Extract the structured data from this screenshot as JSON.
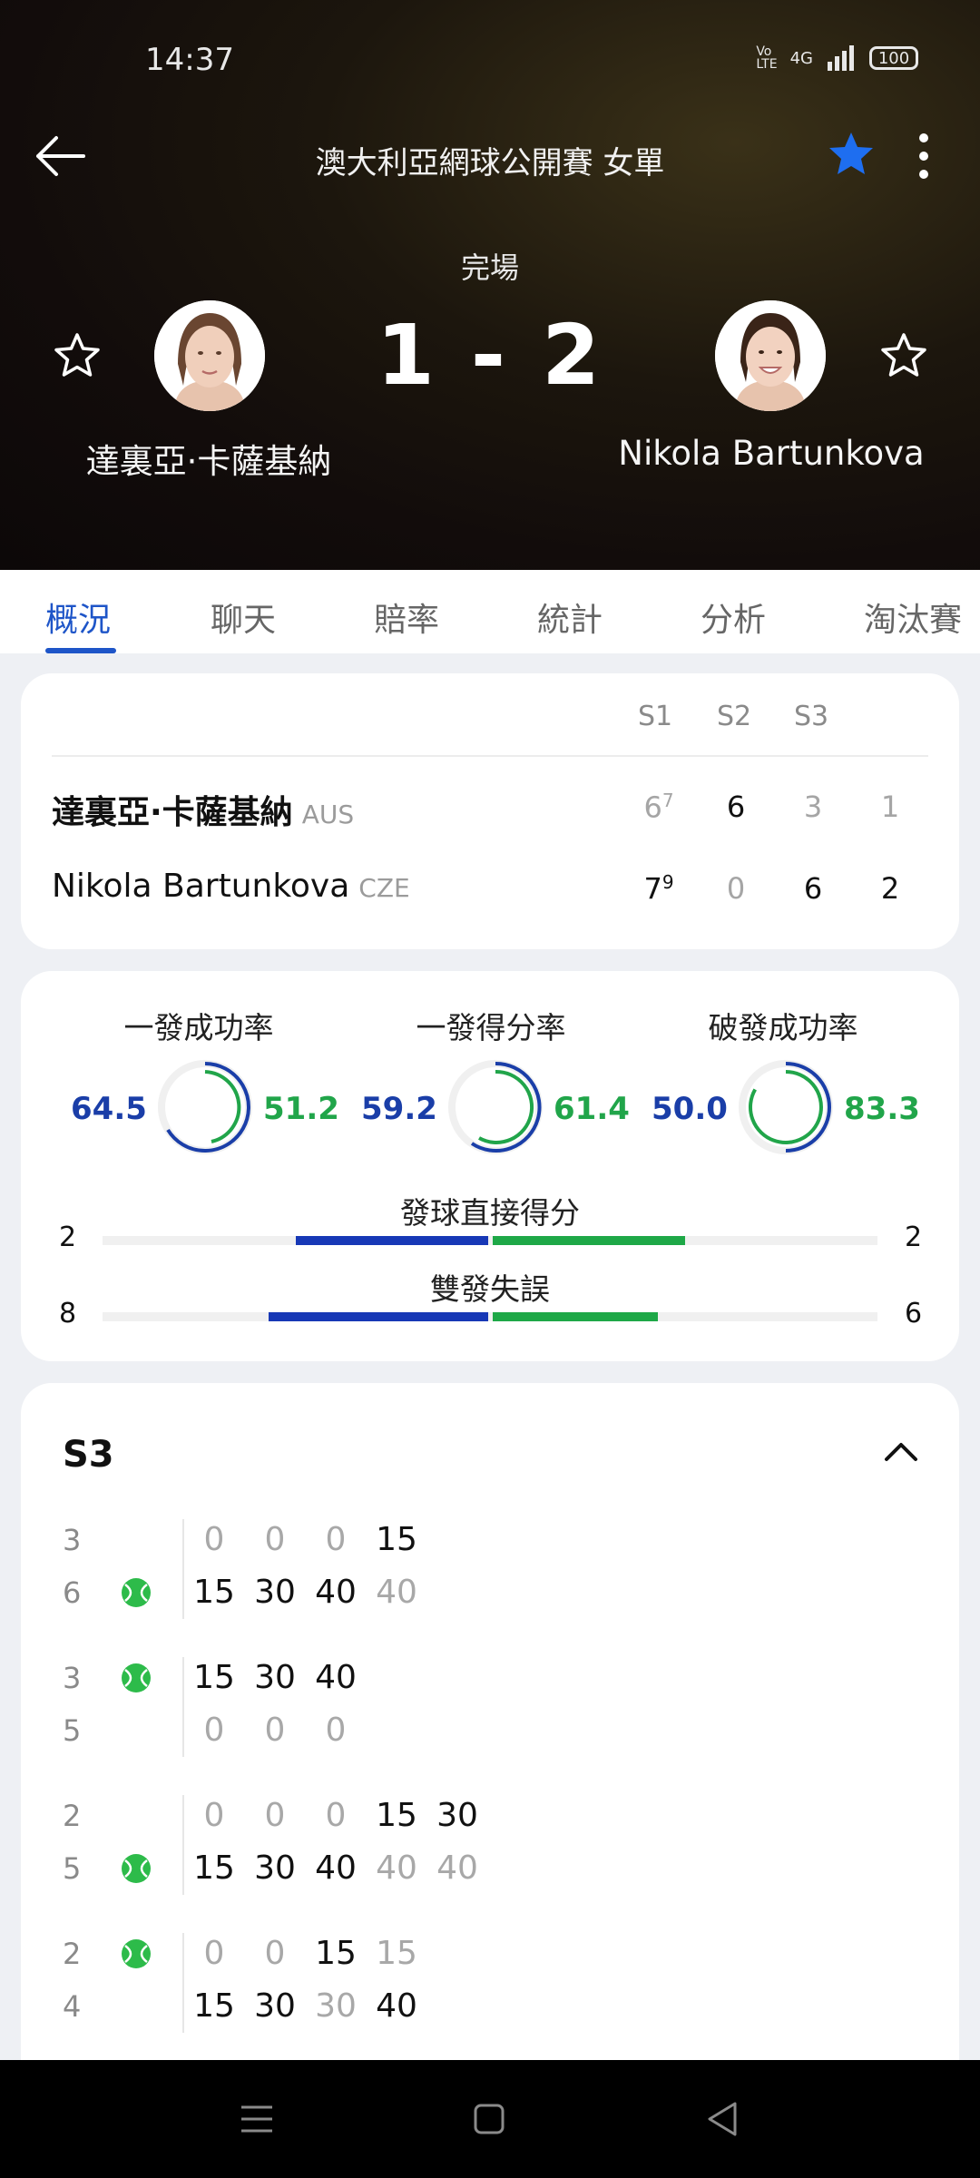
{
  "status": {
    "time": "14:37",
    "network": "4G",
    "battery": "100"
  },
  "header": {
    "title": "澳大利亞網球公開賽 女單",
    "match_status": "完場",
    "score": "1 - 2",
    "player_left": "達裏亞·卡薩基納",
    "player_right": "Nikola Bartunkova"
  },
  "tabs": [
    "概況",
    "聊天",
    "賠率",
    "統計",
    "分析",
    "淘汰賽"
  ],
  "scoreboard": {
    "set_headers": [
      "S1",
      "S2",
      "S3"
    ],
    "rows": [
      {
        "name": "達裏亞·卡薩基納",
        "country": "AUS",
        "s1": "6",
        "s1_tb": "7",
        "s2": "6",
        "s3": "3",
        "total": "1"
      },
      {
        "name": "Nikola Bartunkova",
        "country": "CZE",
        "s1": "7",
        "s1_tb": "9",
        "s2": "0",
        "s3": "6",
        "total": "2"
      }
    ]
  },
  "stats": {
    "rings": [
      {
        "label": "一發成功率",
        "left": "64.5",
        "right": "51.2"
      },
      {
        "label": "一發得分率",
        "left": "59.2",
        "right": "61.4"
      },
      {
        "label": "破發成功率",
        "left": "50.0",
        "right": "83.3"
      }
    ],
    "bars": [
      {
        "label": "發球直接得分",
        "left": "2",
        "right": "2"
      },
      {
        "label": "雙發失誤",
        "left": "8",
        "right": "6"
      }
    ]
  },
  "set_detail": {
    "title": "S3",
    "games": [
      {
        "top_games": "3",
        "bottom_games": "6",
        "server": "bottom",
        "top_points": [
          "0",
          "0",
          "0",
          "15"
        ],
        "top_dim": [
          true,
          true,
          true,
          false
        ],
        "bottom_points": [
          "15",
          "30",
          "40",
          "40"
        ],
        "bottom_dim": [
          false,
          false,
          false,
          true
        ]
      },
      {
        "top_games": "3",
        "bottom_games": "5",
        "server": "top",
        "top_points": [
          "15",
          "30",
          "40"
        ],
        "top_dim": [
          false,
          false,
          false
        ],
        "bottom_points": [
          "0",
          "0",
          "0"
        ],
        "bottom_dim": [
          true,
          true,
          true
        ]
      },
      {
        "top_games": "2",
        "bottom_games": "5",
        "server": "bottom",
        "top_points": [
          "0",
          "0",
          "0",
          "15",
          "30"
        ],
        "top_dim": [
          true,
          true,
          true,
          false,
          false
        ],
        "bottom_points": [
          "15",
          "30",
          "40",
          "40",
          "40"
        ],
        "bottom_dim": [
          false,
          false,
          false,
          true,
          true
        ]
      },
      {
        "top_games": "2",
        "bottom_games": "4",
        "server": "top",
        "top_points": [
          "0",
          "0",
          "15",
          "15"
        ],
        "top_dim": [
          true,
          true,
          false,
          true
        ],
        "bottom_points": [
          "15",
          "30",
          "30",
          "40"
        ],
        "bottom_dim": [
          false,
          false,
          true,
          false
        ]
      }
    ]
  },
  "colors": {
    "accent": "#1e55c8",
    "player1": "#1a3ea8",
    "player2": "#21a54a",
    "favorite": "#1e6ef0"
  }
}
